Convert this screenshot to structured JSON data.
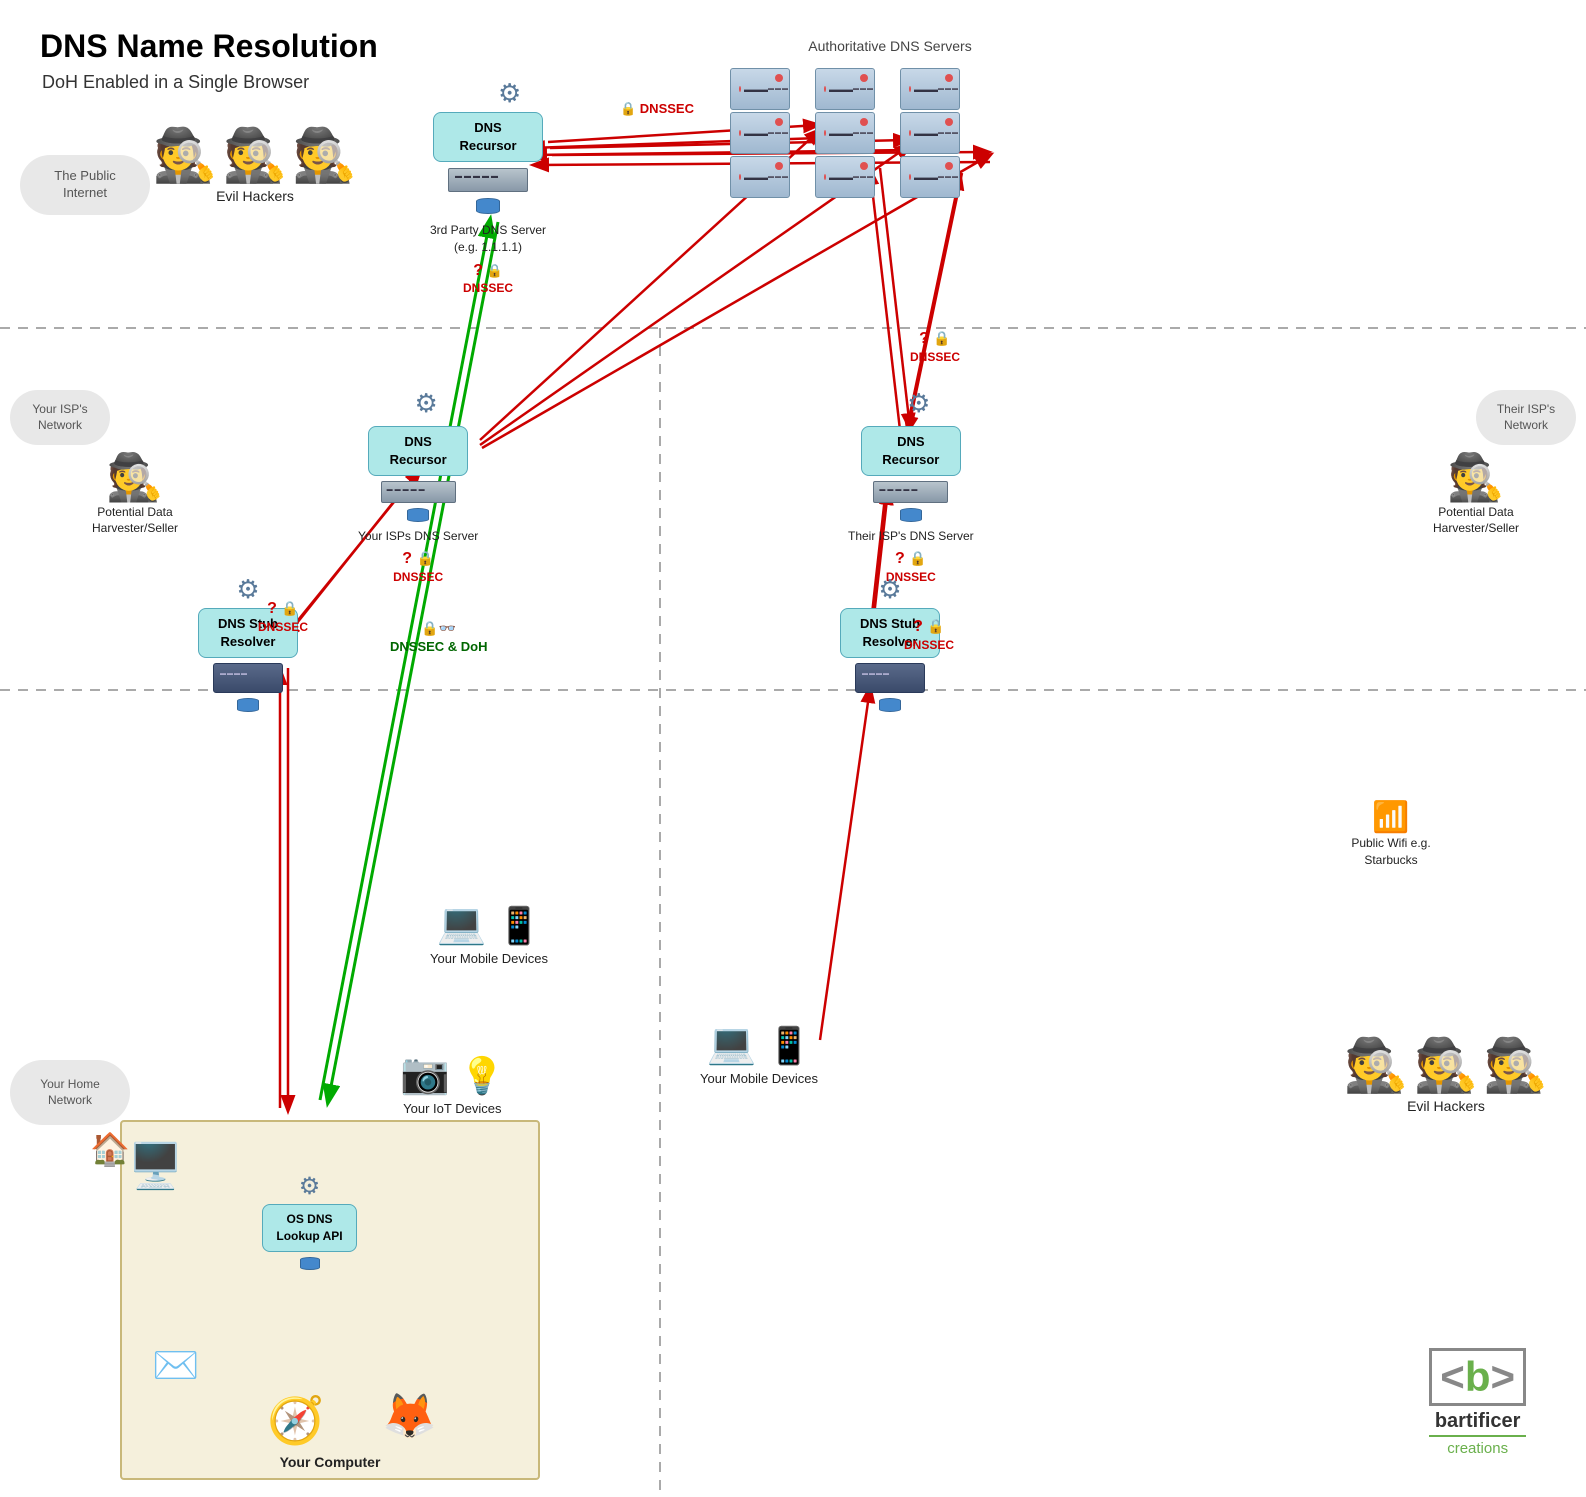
{
  "title": "DNS Name Resolution",
  "subtitle": "DoH Enabled in a Single Browser",
  "clouds": {
    "public_internet": "The Public Internet",
    "isp_network": "Your ISP's Network",
    "their_isp": "Their ISP's Network",
    "home_network": "Your Home Network"
  },
  "labels": {
    "evil_hackers_1": "Evil Hackers",
    "evil_hackers_2": "Evil Hackers",
    "auth_servers": "Authoritative DNS Servers",
    "dns_recursor_3rdparty": "DNS\nRecursor",
    "dns_3rdparty": "3rd Party DNS Server\n(e.g. 1.1.1.1)",
    "dns_recursor_isp": "DNS\nRecursor",
    "your_isp_dns": "Your ISPs DNS Server",
    "dns_recursor_their": "DNS\nRecursor",
    "their_isp_dns": "Their ISP's DNS Server",
    "dns_stub_yours": "DNS Stub\nResolver",
    "dns_stub_their": "DNS Stub\nResolver",
    "os_dns": "OS DNS\nLookup\nAPI",
    "your_computer": "Your Computer",
    "your_mobile": "Your Mobile Devices",
    "your_iot": "Your IoT Devices",
    "their_mobile": "Your Mobile Devices",
    "potential_harvester_1": "Potential Data\nHarvester/Seller",
    "potential_harvester_2": "Potential Data\nHarvester/Seller",
    "public_wifi": "Public Wifi\ne.g.\nStarbucks",
    "dnssec": "DNSSEC",
    "dnssec_doh": "DNSSEC & DoH",
    "bartificer": "<b>",
    "bartificer_name": "bartificer",
    "bartificer_creations": "creations"
  },
  "colors": {
    "red_arrow": "#cc0000",
    "green_arrow": "#00aa00",
    "dnssec_color": "#cc0000",
    "doh_color": "#006600",
    "dns_box_bg": "#aee8e8",
    "home_box_bg": "#f5f0dc",
    "cloud_bg": "#e8e8e8",
    "bartificer_green": "#6ab04c"
  }
}
